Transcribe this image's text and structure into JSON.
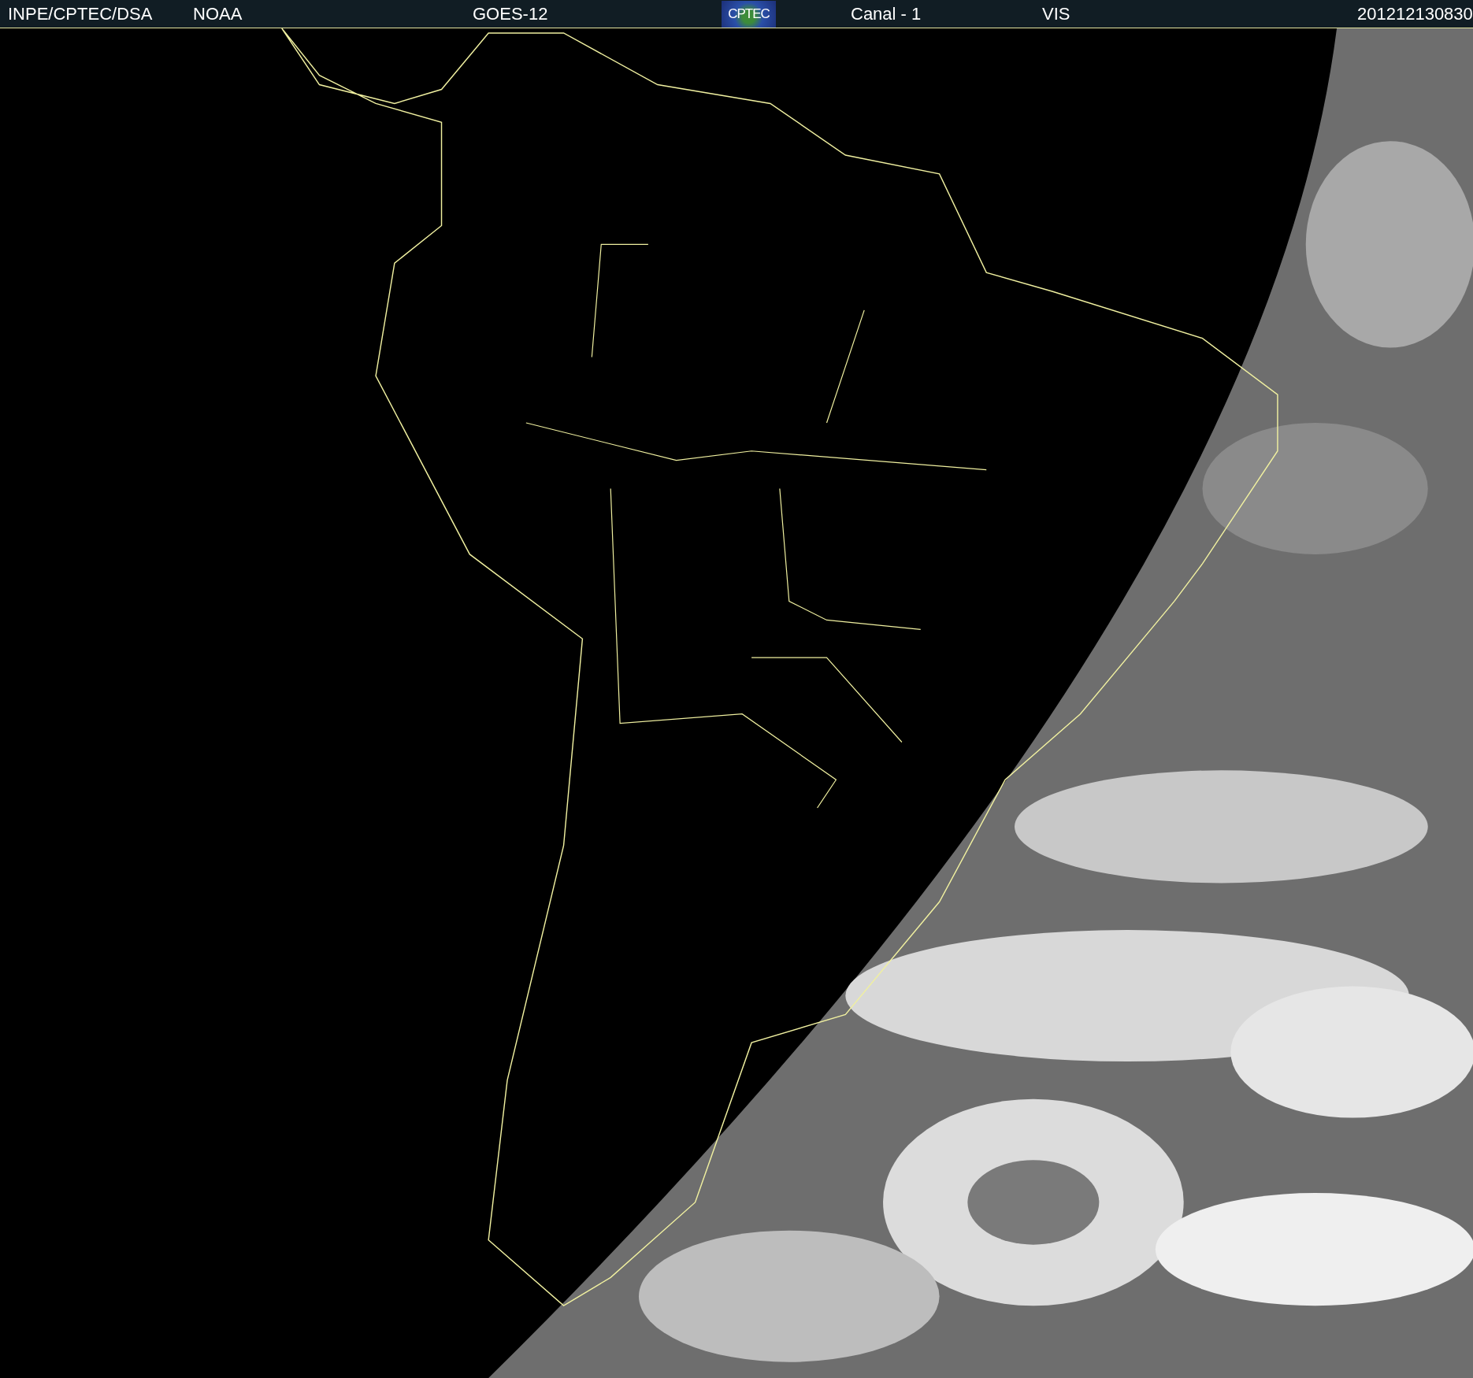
{
  "header": {
    "items": [
      {
        "kind": "text",
        "text": "INPE/CPTEC/DSA"
      },
      {
        "kind": "text",
        "text": "NOAA"
      },
      {
        "kind": "text",
        "text": "GOES-12"
      },
      {
        "kind": "logo",
        "text": "CPTEC"
      },
      {
        "kind": "text",
        "text": "Canal - 1"
      },
      {
        "kind": "text",
        "text": "VIS"
      },
      {
        "kind": "text",
        "text": "201212130830"
      }
    ]
  }
}
